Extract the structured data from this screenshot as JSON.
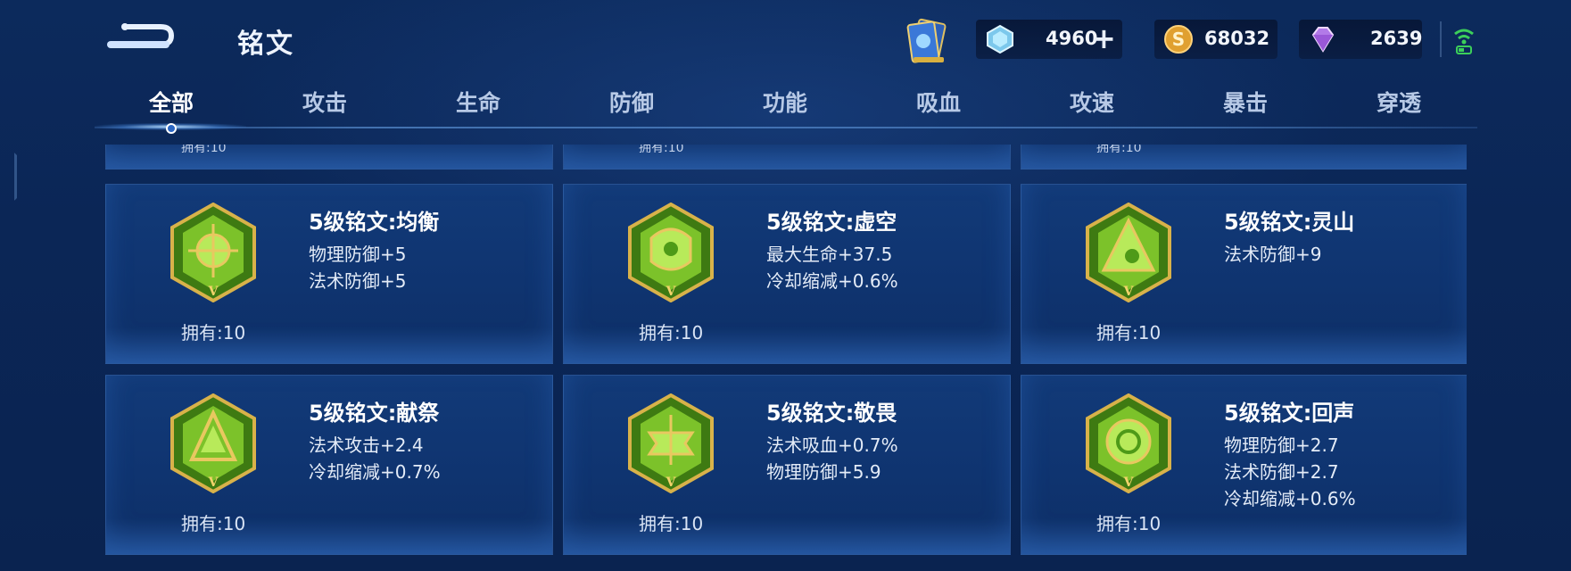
{
  "header": {
    "title": "铭文",
    "currencies": {
      "crystal": "4960",
      "gold": "68032",
      "gem": "2639"
    }
  },
  "tabs": [
    {
      "label": "全部",
      "active": true
    },
    {
      "label": "攻击"
    },
    {
      "label": "生命"
    },
    {
      "label": "防御"
    },
    {
      "label": "功能"
    },
    {
      "label": "吸血"
    },
    {
      "label": "攻速"
    },
    {
      "label": "暴击"
    },
    {
      "label": "穿透"
    }
  ],
  "partial_row": {
    "own_text": "拥有:10"
  },
  "inscriptions": [
    {
      "name": "5级铭文:均衡",
      "attrs": [
        "物理防御+5",
        "法术防御+5"
      ],
      "owned": "拥有:10",
      "level_mark": "V"
    },
    {
      "name": "5级铭文:虚空",
      "attrs": [
        "最大生命+37.5",
        "冷却缩减+0.6%"
      ],
      "owned": "拥有:10",
      "level_mark": "V"
    },
    {
      "name": "5级铭文:灵山",
      "attrs": [
        "法术防御+9"
      ],
      "owned": "拥有:10",
      "level_mark": "V"
    },
    {
      "name": "5级铭文:献祭",
      "attrs": [
        "法术攻击+2.4",
        "冷却缩减+0.7%"
      ],
      "owned": "拥有:10",
      "level_mark": "V"
    },
    {
      "name": "5级铭文:敬畏",
      "attrs": [
        "法术吸血+0.7%",
        "物理防御+5.9"
      ],
      "owned": "拥有:10",
      "level_mark": "V"
    },
    {
      "name": "5级铭文:回声",
      "attrs": [
        "物理防御+2.7",
        "法术防御+2.7",
        "冷却缩减+0.6%"
      ],
      "owned": "拥有:10",
      "level_mark": "V"
    }
  ],
  "colors": {
    "background": "#0b2656",
    "badge_green": "#5aa21e",
    "badge_gold": "#d8b24a",
    "crystal_blue": "#8fd6f0",
    "coin_gold": "#e0a030",
    "gem_purple": "#b27ae8"
  }
}
